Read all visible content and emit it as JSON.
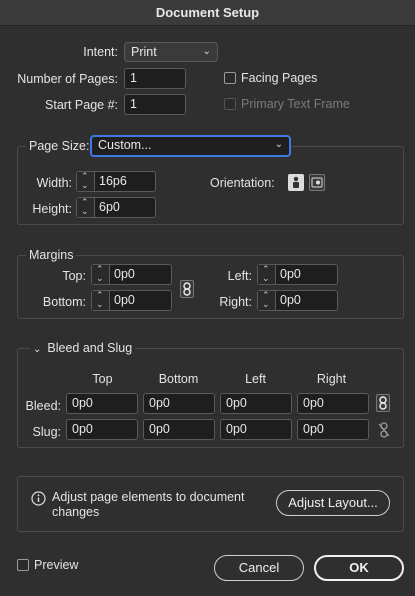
{
  "window": {
    "title": "Document Setup"
  },
  "intent": {
    "label": "Intent:",
    "value": "Print"
  },
  "pages": {
    "number_label": "Number of Pages:",
    "number_value": "1",
    "start_label": "Start Page #:",
    "start_value": "1",
    "facing_label": "Facing Pages",
    "primary_frame_label": "Primary Text Frame"
  },
  "page_size": {
    "label": "Page Size:",
    "value": "Custom...",
    "width_label": "Width:",
    "width_value": "16p6",
    "height_label": "Height:",
    "height_value": "6p0",
    "orientation_label": "Orientation:"
  },
  "margins": {
    "title": "Margins",
    "top_label": "Top:",
    "top_value": "0p0",
    "bottom_label": "Bottom:",
    "bottom_value": "0p0",
    "left_label": "Left:",
    "left_value": "0p0",
    "right_label": "Right:",
    "right_value": "0p0"
  },
  "bleed_slug": {
    "title": "Bleed and Slug",
    "columns": [
      "Top",
      "Bottom",
      "Left",
      "Right"
    ],
    "bleed_label": "Bleed:",
    "bleed_values": [
      "0p0",
      "0p0",
      "0p0",
      "0p0"
    ],
    "slug_label": "Slug:",
    "slug_values": [
      "0p0",
      "0p0",
      "0p0",
      "0p0"
    ]
  },
  "adjust": {
    "info_text": "Adjust page elements to document changes",
    "button_label": "Adjust Layout..."
  },
  "footer": {
    "preview_label": "Preview",
    "cancel_label": "Cancel",
    "ok_label": "OK"
  },
  "icons": {
    "chevron": "chevron-down-icon",
    "link": "link-icon",
    "unlink": "unlink-icon",
    "info": "info-icon",
    "portrait": "portrait-orientation-icon",
    "landscape": "landscape-orientation-icon"
  },
  "colors": {
    "focus_accent": "#3d7be0",
    "background": "#2f2f2f",
    "field": "#1e1e1e"
  }
}
